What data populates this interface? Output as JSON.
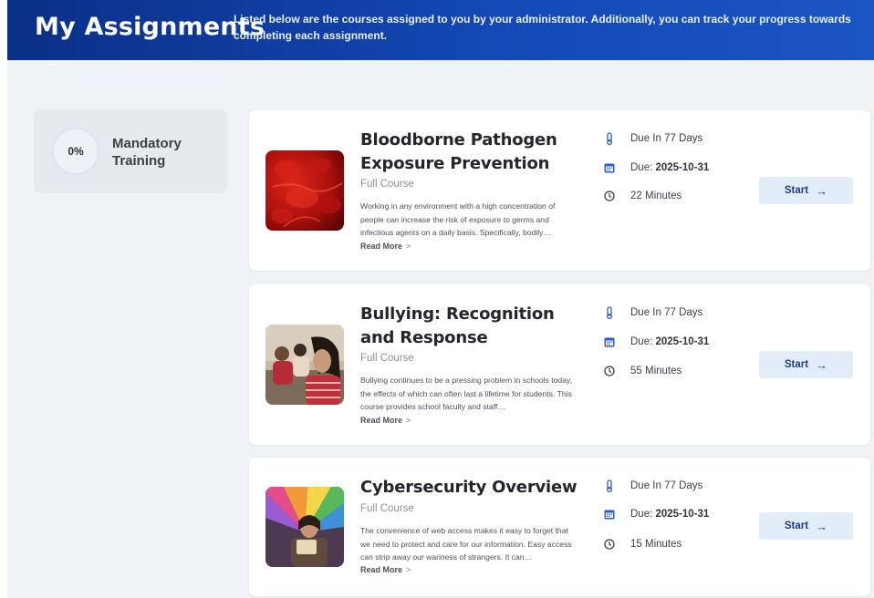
{
  "header": {
    "title": "My Assignments",
    "description": "Listed below are the courses assigned to you by your administrator. Additionally, you can track your progress towards completing each assignment."
  },
  "progress": {
    "percent_label": "0%",
    "percent": 0,
    "label": "Mandatory Training"
  },
  "colors": {
    "header_start": "#0b2f86",
    "header_end": "#1a56c4",
    "button_bg": "#e3edf9",
    "button_text": "#1d3f8a",
    "icon_blue": "#2b5fc7"
  },
  "courses": [
    {
      "title": "Bloodborne Pathogen Exposure Prevention",
      "type": "Full Course",
      "description": "Working in any environment with a high concentration of people can increase the risk of exposure to germs and infectious agents on a daily basis. Specifically, bodily…",
      "read_more": "Read More",
      "due_in": "Due In 77 Days",
      "due_label": "Due:",
      "due_date": "2025-10-31",
      "duration": "22 Minutes",
      "start_label": "Start",
      "icons": [
        "thermometer-icon",
        "calendar-icon",
        "clock-icon"
      ]
    },
    {
      "title": "Bullying: Recognition and Response",
      "type": "Full Course",
      "description": "Bullying continues to be a pressing problem in schools today, the effects of which can often last a lifetime for students. This course provides school faculty and staff…",
      "read_more": "Read More",
      "due_in": "Due In 77 Days",
      "due_label": "Due:",
      "due_date": "2025-10-31",
      "duration": "55 Minutes",
      "start_label": "Start",
      "icons": [
        "thermometer-icon",
        "calendar-icon",
        "clock-icon"
      ]
    },
    {
      "title": "Cybersecurity Overview",
      "type": "Full Course",
      "description": "The convenience of web access makes it easy to forget that we need to protect and care for our information. Easy access can strip away our wariness of strangers. It can…",
      "read_more": "Read More",
      "due_in": "Due In 77 Days",
      "due_label": "Due:",
      "due_date": "2025-10-31",
      "duration": "15 Minutes",
      "start_label": "Start",
      "icons": [
        "thermometer-icon",
        "calendar-icon",
        "clock-icon"
      ]
    }
  ]
}
